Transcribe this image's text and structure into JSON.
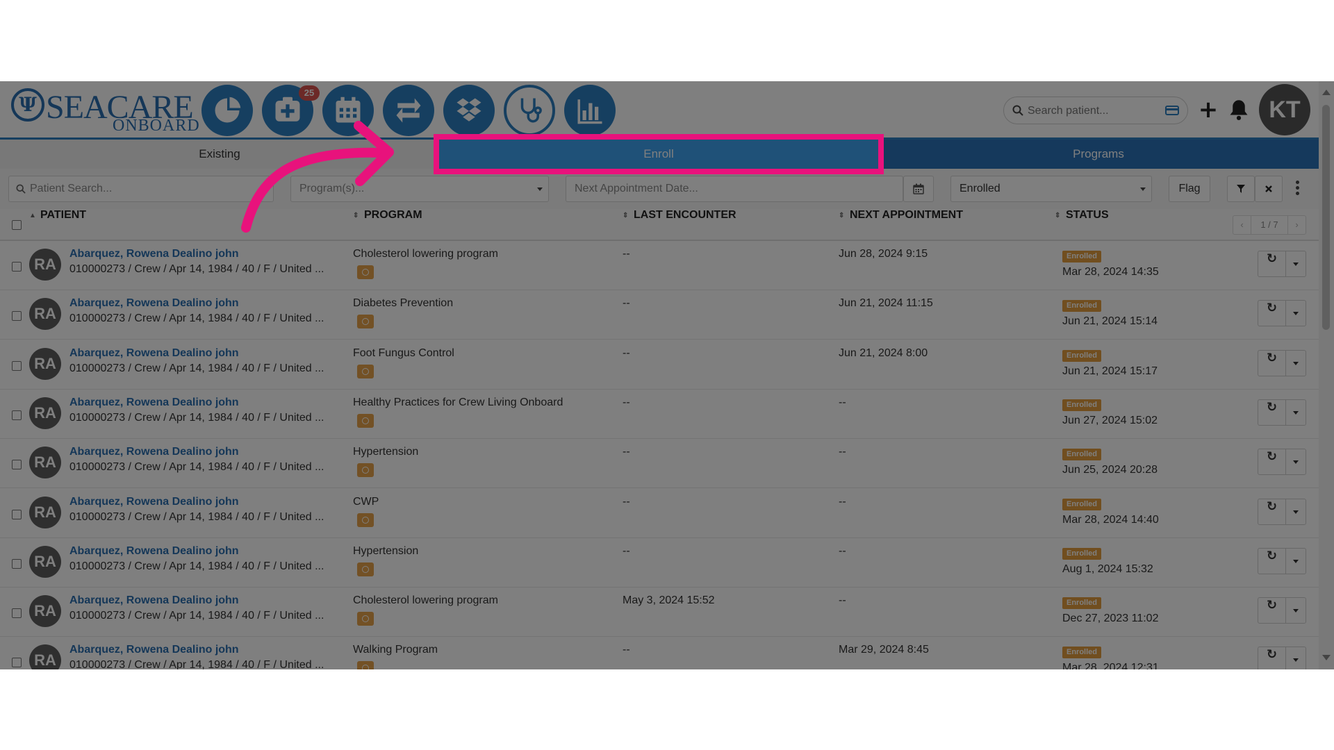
{
  "brand": {
    "name": "SEACARE",
    "sub": "ONBOARD",
    "mark": "Ψ"
  },
  "nav": {
    "notif_count": "25",
    "icons": [
      "pie-chart-icon",
      "medical-plus-icon",
      "calendar-icon",
      "transfer-arrows-icon",
      "dropbox-icon",
      "stethoscope-icon",
      "bar-chart-icon"
    ]
  },
  "search": {
    "placeholder": "Search patient..."
  },
  "user": {
    "initials": "KT"
  },
  "tabs": {
    "existing": "Existing",
    "enroll": "Enroll",
    "programs": "Programs"
  },
  "filters": {
    "patient_placeholder": "Patient Search...",
    "program_placeholder": "Program(s)...",
    "date_placeholder": "Next Appointment Date...",
    "status_value": "Enrolled",
    "flag_label": "Flag"
  },
  "columns": {
    "patient": "PATIENT",
    "program": "PROGRAM",
    "last_encounter": "LAST ENCOUNTER",
    "next_appointment": "NEXT APPOINTMENT",
    "status": "STATUS"
  },
  "pager": {
    "prev": "‹",
    "label": "1 / 7",
    "next": "›"
  },
  "rows": [
    {
      "initials": "RA",
      "name": "Abarquez, Rowena Dealino john",
      "detail": "010000273 / Crew / Apr 14, 1984 / 40 / F / United ...",
      "program": "Cholesterol lowering program",
      "last_encounter": "--",
      "next_appointment": "Jun 28, 2024 9:15",
      "status": "Enrolled",
      "status_date": "Mar 28, 2024 14:35"
    },
    {
      "initials": "RA",
      "name": "Abarquez, Rowena Dealino john",
      "detail": "010000273 / Crew / Apr 14, 1984 / 40 / F / United ...",
      "program": "Diabetes Prevention",
      "last_encounter": "--",
      "next_appointment": "Jun 21, 2024 11:15",
      "status": "Enrolled",
      "status_date": "Jun 21, 2024 15:14"
    },
    {
      "initials": "RA",
      "name": "Abarquez, Rowena Dealino john",
      "detail": "010000273 / Crew / Apr 14, 1984 / 40 / F / United ...",
      "program": "Foot Fungus Control",
      "last_encounter": "--",
      "next_appointment": "Jun 21, 2024 8:00",
      "status": "Enrolled",
      "status_date": "Jun 21, 2024 15:17"
    },
    {
      "initials": "RA",
      "name": "Abarquez, Rowena Dealino john",
      "detail": "010000273 / Crew / Apr 14, 1984 / 40 / F / United ...",
      "program": "Healthy Practices for Crew Living Onboard",
      "last_encounter": "--",
      "next_appointment": "--",
      "status": "Enrolled",
      "status_date": "Jun 27, 2024 15:02"
    },
    {
      "initials": "RA",
      "name": "Abarquez, Rowena Dealino john",
      "detail": "010000273 / Crew / Apr 14, 1984 / 40 / F / United ...",
      "program": "Hypertension",
      "last_encounter": "--",
      "next_appointment": "--",
      "status": "Enrolled",
      "status_date": "Jun 25, 2024 20:28"
    },
    {
      "initials": "RA",
      "name": "Abarquez, Rowena Dealino john",
      "detail": "010000273 / Crew / Apr 14, 1984 / 40 / F / United ...",
      "program": "CWP",
      "last_encounter": "--",
      "next_appointment": "--",
      "status": "Enrolled",
      "status_date": "Mar 28, 2024 14:40"
    },
    {
      "initials": "RA",
      "name": "Abarquez, Rowena Dealino john",
      "detail": "010000273 / Crew / Apr 14, 1984 / 40 / F / United ...",
      "program": "Hypertension",
      "last_encounter": "--",
      "next_appointment": "--",
      "status": "Enrolled",
      "status_date": "Aug 1, 2024 15:32"
    },
    {
      "initials": "RA",
      "name": "Abarquez, Rowena Dealino john",
      "detail": "010000273 / Crew / Apr 14, 1984 / 40 / F / United ...",
      "program": "Cholesterol lowering program",
      "last_encounter": "May 3, 2024 15:52",
      "next_appointment": "--",
      "status": "Enrolled",
      "status_date": "Dec 27, 2023 11:02"
    },
    {
      "initials": "RA",
      "name": "Abarquez, Rowena Dealino john",
      "detail": "010000273 / Crew / Apr 14, 1984 / 40 / F / United ...",
      "program": "Walking Program",
      "last_encounter": "--",
      "next_appointment": "Mar 29, 2024 8:45",
      "status": "Enrolled",
      "status_date": "Mar 28, 2024 12:31"
    }
  ],
  "colors": {
    "brand_blue": "#2d7fc1",
    "enroll_tab": "#3fa3f0",
    "programs_tab": "#2a73b8",
    "status_badge": "#e29c3e",
    "highlight": "#e8127c",
    "badge_red": "#d9534f"
  }
}
